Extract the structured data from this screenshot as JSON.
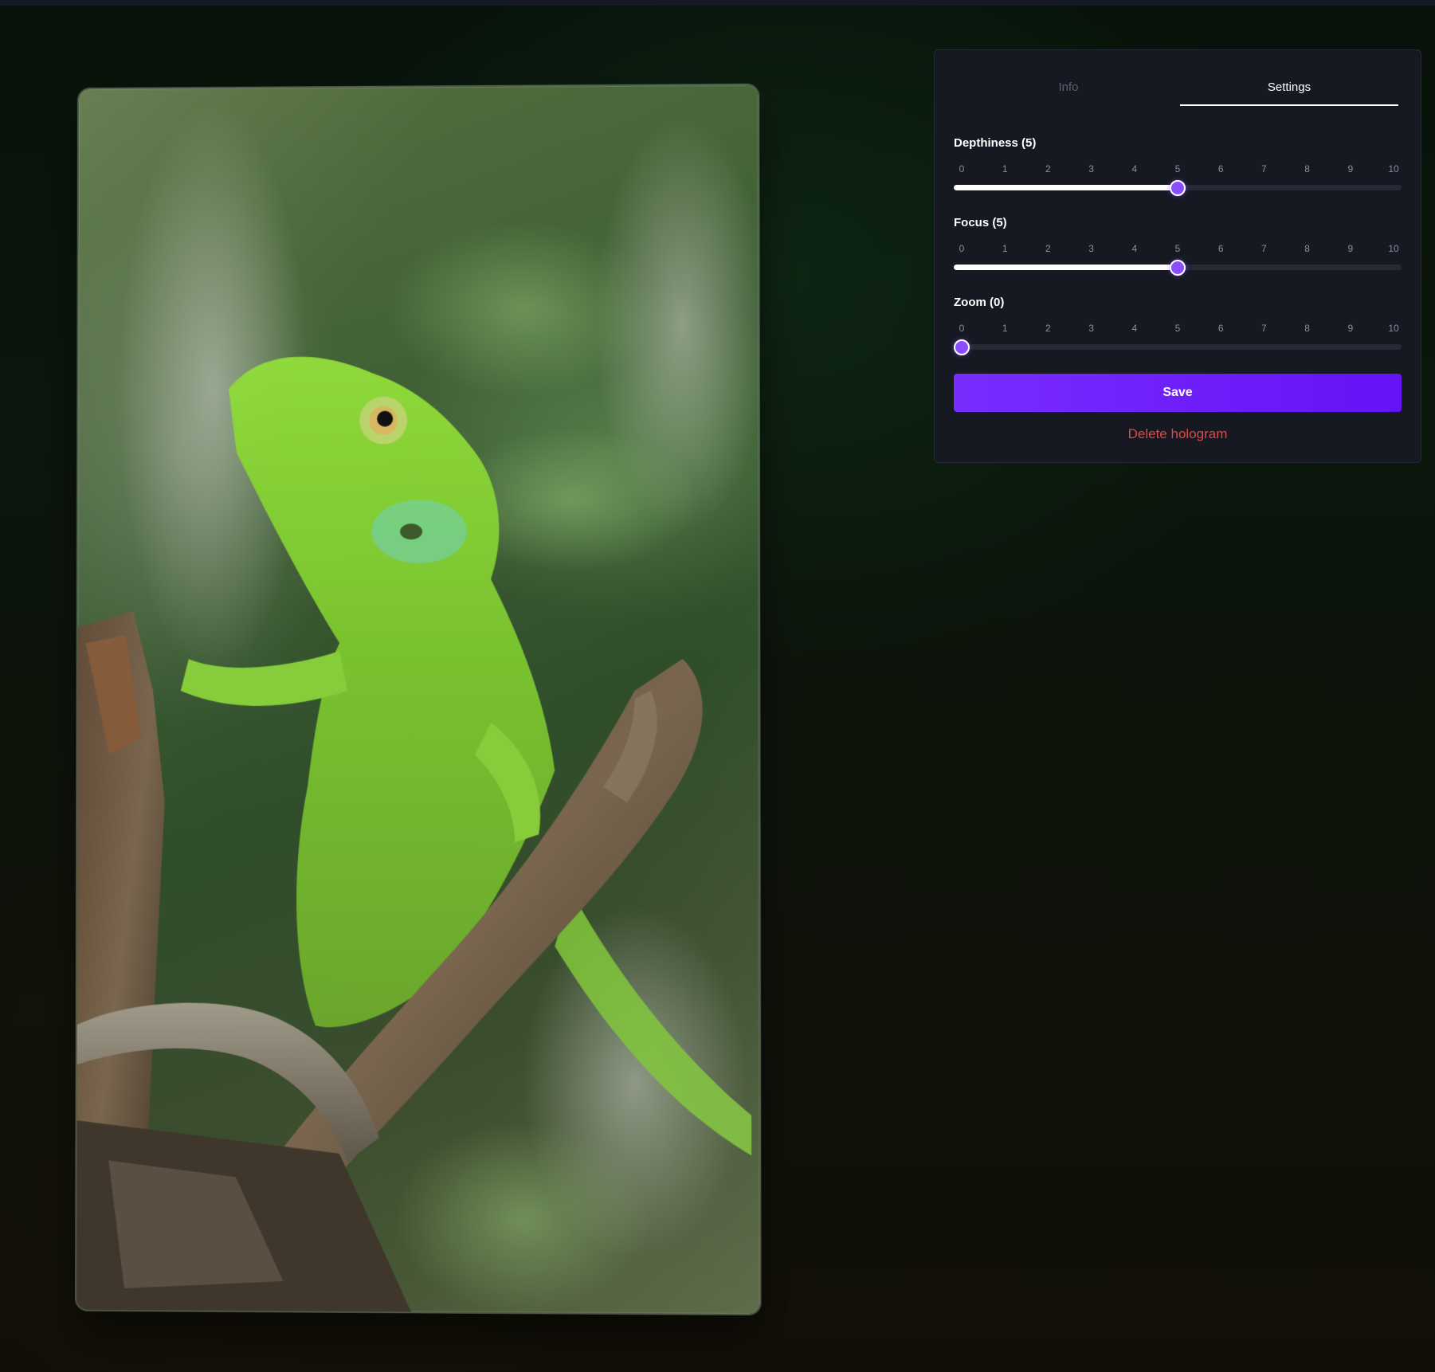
{
  "tabs": {
    "info_label": "Info",
    "settings_label": "Settings",
    "active": "Settings"
  },
  "sliders": [
    {
      "label": "Depthiness (5)",
      "value": 5,
      "min": 0,
      "max": 10,
      "ticks": [
        "0",
        "1",
        "2",
        "3",
        "4",
        "5",
        "6",
        "7",
        "8",
        "9",
        "10"
      ]
    },
    {
      "label": "Focus (5)",
      "value": 5,
      "min": 0,
      "max": 10,
      "ticks": [
        "0",
        "1",
        "2",
        "3",
        "4",
        "5",
        "6",
        "7",
        "8",
        "9",
        "10"
      ]
    },
    {
      "label": "Zoom (0)",
      "value": 0,
      "min": 0,
      "max": 10,
      "ticks": [
        "0",
        "1",
        "2",
        "3",
        "4",
        "5",
        "6",
        "7",
        "8",
        "9",
        "10"
      ]
    }
  ],
  "actions": {
    "save_label": "Save",
    "delete_label": "Delete hologram"
  },
  "colors": {
    "accent": "#8a4dff",
    "save_button": "#6f1ff8",
    "delete_text": "#e04848",
    "panel_bg": "#161922"
  },
  "hologram": {
    "subject": "green-lizard-on-branch"
  }
}
